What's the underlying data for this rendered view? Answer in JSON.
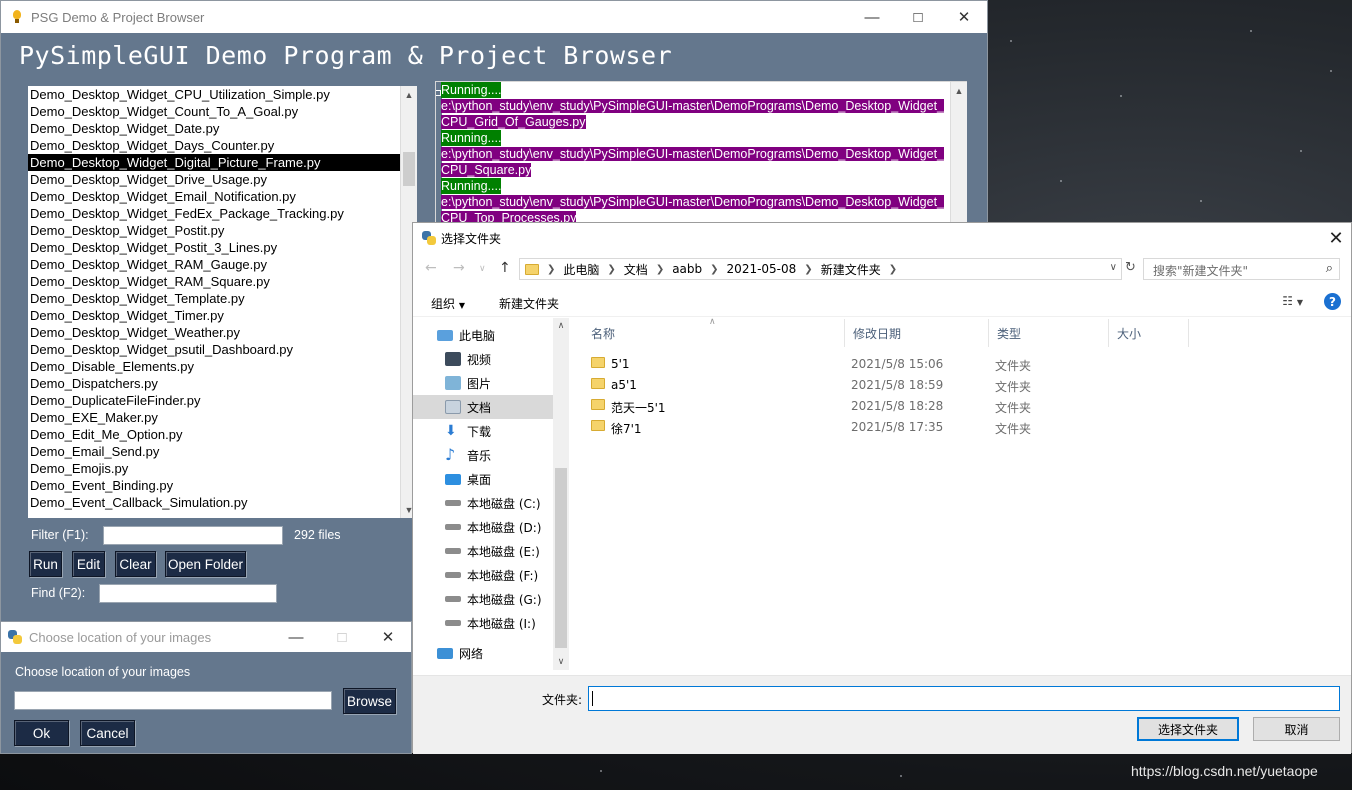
{
  "main_window": {
    "title": "PSG Demo & Project Browser",
    "heading": "PySimpleGUI Demo Program & Project Browser",
    "files": [
      "Demo_Desktop_Widget_CPU_Utilization_Simple.py",
      "Demo_Desktop_Widget_Count_To_A_Goal.py",
      "Demo_Desktop_Widget_Date.py",
      "Demo_Desktop_Widget_Days_Counter.py",
      "Demo_Desktop_Widget_Digital_Picture_Frame.py",
      "Demo_Desktop_Widget_Drive_Usage.py",
      "Demo_Desktop_Widget_Email_Notification.py",
      "Demo_Desktop_Widget_FedEx_Package_Tracking.py",
      "Demo_Desktop_Widget_Postit.py",
      "Demo_Desktop_Widget_Postit_3_Lines.py",
      "Demo_Desktop_Widget_RAM_Gauge.py",
      "Demo_Desktop_Widget_RAM_Square.py",
      "Demo_Desktop_Widget_Template.py",
      "Demo_Desktop_Widget_Timer.py",
      "Demo_Desktop_Widget_Weather.py",
      "Demo_Desktop_Widget_psutil_Dashboard.py",
      "Demo_Disable_Elements.py",
      "Demo_Dispatchers.py",
      "Demo_DuplicateFileFinder.py",
      "Demo_EXE_Maker.py",
      "Demo_Edit_Me_Option.py",
      "Demo_Email_Send.py",
      "Demo_Emojis.py",
      "Demo_Event_Binding.py",
      "Demo_Event_Callback_Simulation.py"
    ],
    "selected_index": 4,
    "output": [
      {
        "kind": "run",
        "text": "Running...."
      },
      {
        "kind": "path",
        "text": "e:\\python_study\\env_study\\PySimpleGUI-master\\DemoPrograms\\Demo_Desktop_Widget_CPU_Grid_Of_Gauges.py"
      },
      {
        "kind": "run",
        "text": "Running...."
      },
      {
        "kind": "path",
        "text": "e:\\python_study\\env_study\\PySimpleGUI-master\\DemoPrograms\\Demo_Desktop_Widget_CPU_Square.py"
      },
      {
        "kind": "run",
        "text": "Running...."
      },
      {
        "kind": "path",
        "text": "e:\\python_study\\env_study\\PySimpleGUI-master\\DemoPrograms\\Demo_Desktop_Widget_CPU_Top_Processes.py"
      }
    ],
    "filter_label": "Filter (F1):",
    "files_count": "292 files",
    "find_label": "Find (F2):",
    "buttons": {
      "run": "Run",
      "edit": "Edit",
      "clear": "Clear",
      "open_folder": "Open Folder"
    }
  },
  "popup": {
    "title": "Choose location of your images",
    "label": "Choose location of your images",
    "browse": "Browse",
    "ok": "Ok",
    "cancel": "Cancel"
  },
  "dialog": {
    "title": "选择文件夹",
    "breadcrumb": [
      "此电脑",
      "文档",
      "aabb",
      "2021-05-08",
      "新建文件夹"
    ],
    "search_placeholder": "搜索\"新建文件夹\"",
    "organize": "组织",
    "new_folder": "新建文件夹",
    "nav_items": [
      {
        "label": "此电脑",
        "icon": "computer-icon"
      },
      {
        "label": "视频",
        "icon": "video-icon"
      },
      {
        "label": "图片",
        "icon": "pictures-icon"
      },
      {
        "label": "文档",
        "icon": "documents-icon"
      },
      {
        "label": "下载",
        "icon": "download-icon"
      },
      {
        "label": "音乐",
        "icon": "music-icon"
      },
      {
        "label": "桌面",
        "icon": "desktop-icon"
      },
      {
        "label": "本地磁盘 (C:)",
        "icon": "drive-icon"
      },
      {
        "label": "本地磁盘 (D:)",
        "icon": "drive-icon"
      },
      {
        "label": "本地磁盘 (E:)",
        "icon": "drive-icon"
      },
      {
        "label": "本地磁盘 (F:)",
        "icon": "drive-icon"
      },
      {
        "label": "本地磁盘 (G:)",
        "icon": "drive-icon"
      },
      {
        "label": "本地磁盘 (I:)",
        "icon": "drive-icon"
      },
      {
        "label": "网络",
        "icon": "network-icon"
      }
    ],
    "selected_nav": 3,
    "columns": [
      "名称",
      "修改日期",
      "类型",
      "大小"
    ],
    "rows": [
      {
        "name": "5'1",
        "date": "2021/5/8 15:06",
        "type": "文件夹"
      },
      {
        "name": "a5'1",
        "date": "2021/5/8 18:59",
        "type": "文件夹"
      },
      {
        "name": "范天一5'1",
        "date": "2021/5/8 18:28",
        "type": "文件夹"
      },
      {
        "name": "徐7'1",
        "date": "2021/5/8 17:35",
        "type": "文件夹"
      }
    ],
    "folder_label": "文件夹:",
    "select_button": "选择文件夹",
    "cancel_button": "取消"
  },
  "watermark": "https://blog.csdn.net/yuetaope"
}
